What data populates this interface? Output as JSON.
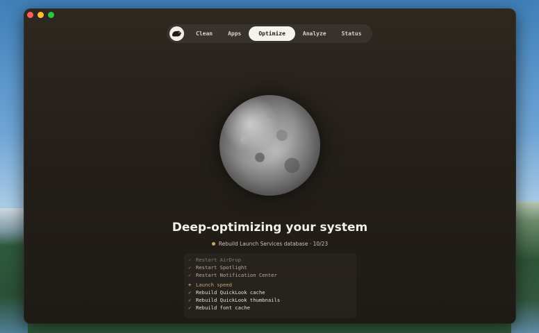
{
  "nav": {
    "tabs": [
      {
        "label": "Clean",
        "active": false
      },
      {
        "label": "Apps",
        "active": false
      },
      {
        "label": "Optimize",
        "active": true
      },
      {
        "label": "Analyze",
        "active": false
      },
      {
        "label": "Status",
        "active": false
      }
    ]
  },
  "main": {
    "title": "Deep-optimizing your system",
    "status_text": "Rebuild Launch Services database · 10/23",
    "status_dot_color": "#c9a56a"
  },
  "log": {
    "items": [
      {
        "mark": "✓",
        "text": "Restart AirDrop"
      },
      {
        "mark": "✓",
        "text": "Restart Spotlight"
      },
      {
        "mark": "✓",
        "text": "Restart Notification Center"
      },
      {
        "mark": "+",
        "text": "Launch speed"
      },
      {
        "mark": "✓",
        "text": "Rebuild QuickLook cache"
      },
      {
        "mark": "✓",
        "text": "Rebuild QuickLook thumbnails"
      },
      {
        "mark": "✓",
        "text": "Rebuild font cache"
      }
    ]
  },
  "colors": {
    "accent": "#c9a56a",
    "active_tab_bg": "#f6f3ee",
    "window_bg": "#241f19"
  }
}
